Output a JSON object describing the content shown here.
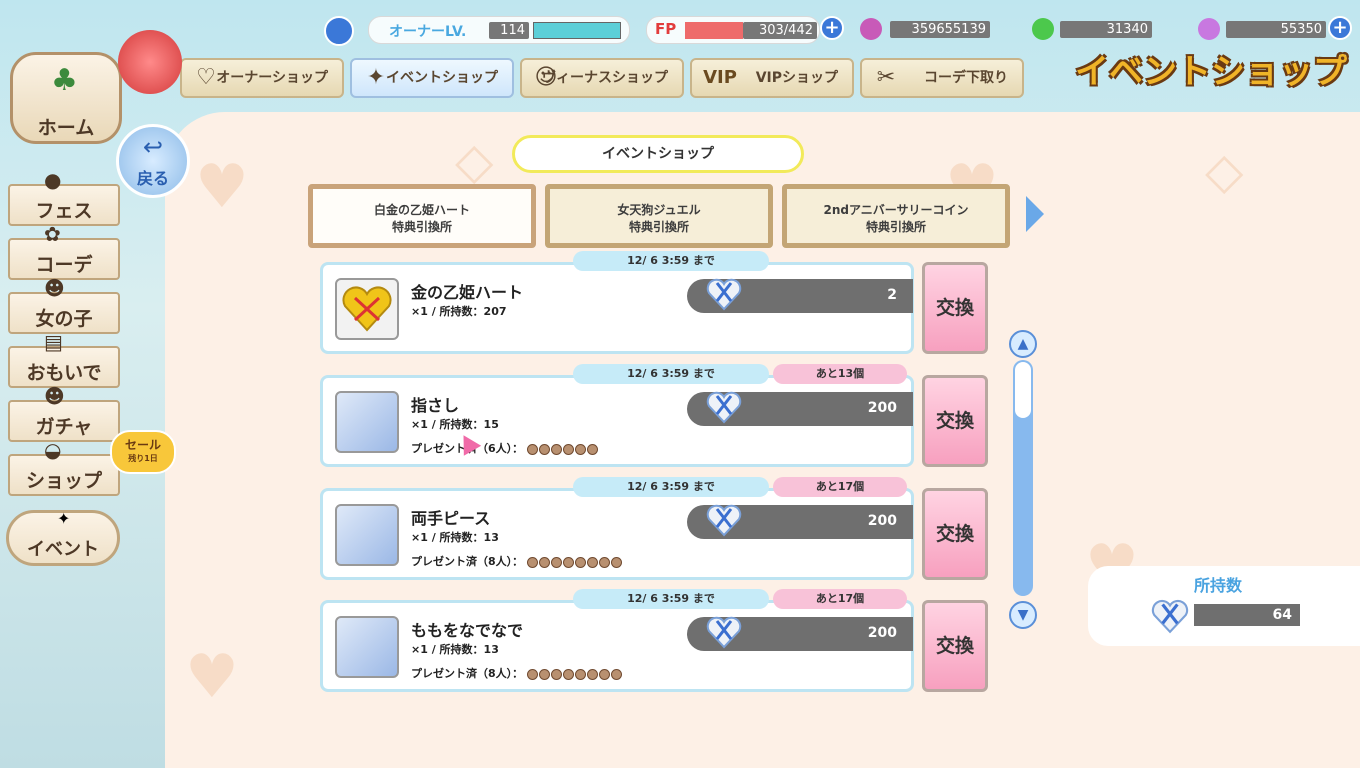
{
  "header": {
    "page_title": "イベントショップ",
    "owner_level_label": "オーナーLV.",
    "owner_level": "114",
    "fp_label": "FP",
    "fp_value": "303/442",
    "currency_1": "359655139",
    "currency_2": "31340",
    "currency_3": "55350"
  },
  "shop_tabs": [
    {
      "label": "オーナーショップ",
      "icon": "fp-coin-icon"
    },
    {
      "label": "イベントショップ",
      "icon": "confetti-icon",
      "active": true
    },
    {
      "label": "ヴィーナスショップ",
      "icon": "venus-face-icon"
    },
    {
      "label": "VIPショップ",
      "icon": "vip-icon",
      "badge": "VIP"
    },
    {
      "label": "コーデ下取り",
      "icon": "outfit-icon"
    }
  ],
  "sidebar": {
    "home_label": "ホーム",
    "back_label": "戻る",
    "items": [
      {
        "label": "フェス"
      },
      {
        "label": "コーデ"
      },
      {
        "label": "女の子"
      },
      {
        "label": "おもいで"
      },
      {
        "label": "ガチャ"
      },
      {
        "label": "ショップ"
      },
      {
        "label": "イベント"
      }
    ],
    "sale_badge": "セール",
    "sale_sub": "残り1日"
  },
  "section_title": "イベントショップ",
  "event_tabs": [
    {
      "line1": "白金の乙姫ハート",
      "line2": "特典引換所",
      "active": true
    },
    {
      "line1": "女天狗ジュエル",
      "line2": "特典引換所"
    },
    {
      "line1": "2ndアニバーサリーコイン",
      "line2": "特典引換所"
    }
  ],
  "items": [
    {
      "name": "金の乙姫ハート",
      "sub": "×1 / 所持数：207",
      "deadline": "12/ 6 3:59 まで",
      "remain": "",
      "gift": "",
      "cost": "2",
      "button": "交換"
    },
    {
      "name": "指さし",
      "sub": "×1 / 所持数：15",
      "deadline": "12/ 6 3:59 まで",
      "remain": "あと13個",
      "gift": "プレゼント済（6人）：",
      "cost": "200",
      "button": "交換"
    },
    {
      "name": "両手ピース",
      "sub": "×1 / 所持数：13",
      "deadline": "12/ 6 3:59 まで",
      "remain": "あと17個",
      "gift": "プレゼント済（8人）：",
      "cost": "200",
      "button": "交換"
    },
    {
      "name": "ももをなでなで",
      "sub": "×1 / 所持数：13",
      "deadline": "12/ 6 3:59 まで",
      "remain": "あと17個",
      "gift": "プレゼント済（8人）：",
      "cost": "200",
      "button": "交換"
    }
  ],
  "owned": {
    "label": "所持数",
    "value": "64"
  },
  "colors": {
    "accent_blue": "#3b78d8",
    "exchange_pink": "#f7a0bf",
    "panel_bg": "#fdf0e6"
  }
}
